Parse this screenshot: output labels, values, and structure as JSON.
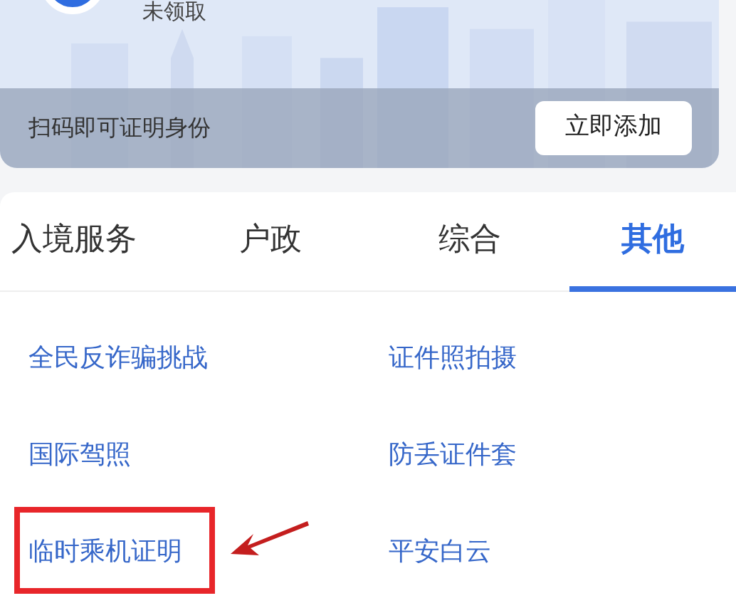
{
  "card": {
    "status": "未领取",
    "hint": "扫码即可证明身份",
    "button": "立即添加"
  },
  "tabs": [
    {
      "label": "入境服务",
      "selected": false
    },
    {
      "label": "户政",
      "selected": false
    },
    {
      "label": "综合",
      "selected": false
    },
    {
      "label": "其他",
      "selected": true
    }
  ],
  "items": [
    {
      "label": "全民反诈骗挑战",
      "highlighted": false
    },
    {
      "label": "证件照拍摄",
      "highlighted": false
    },
    {
      "label": "国际驾照",
      "highlighted": false
    },
    {
      "label": "防丢证件套",
      "highlighted": false
    },
    {
      "label": "临时乘机证明",
      "highlighted": true
    },
    {
      "label": "平安白云",
      "highlighted": false
    }
  ]
}
